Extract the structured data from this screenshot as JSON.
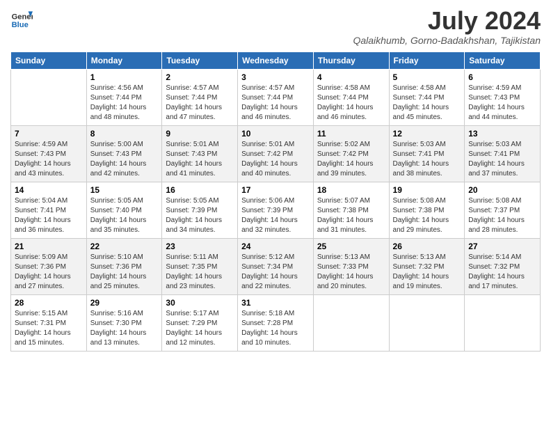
{
  "header": {
    "logo_line1": "General",
    "logo_line2": "Blue",
    "title": "July 2024",
    "subtitle": "Qalaikhumb, Gorno-Badakhshan, Tajikistan"
  },
  "days_of_week": [
    "Sunday",
    "Monday",
    "Tuesday",
    "Wednesday",
    "Thursday",
    "Friday",
    "Saturday"
  ],
  "weeks": [
    [
      {
        "num": "",
        "info": ""
      },
      {
        "num": "1",
        "info": "Sunrise: 4:56 AM\nSunset: 7:44 PM\nDaylight: 14 hours\nand 48 minutes."
      },
      {
        "num": "2",
        "info": "Sunrise: 4:57 AM\nSunset: 7:44 PM\nDaylight: 14 hours\nand 47 minutes."
      },
      {
        "num": "3",
        "info": "Sunrise: 4:57 AM\nSunset: 7:44 PM\nDaylight: 14 hours\nand 46 minutes."
      },
      {
        "num": "4",
        "info": "Sunrise: 4:58 AM\nSunset: 7:44 PM\nDaylight: 14 hours\nand 46 minutes."
      },
      {
        "num": "5",
        "info": "Sunrise: 4:58 AM\nSunset: 7:44 PM\nDaylight: 14 hours\nand 45 minutes."
      },
      {
        "num": "6",
        "info": "Sunrise: 4:59 AM\nSunset: 7:43 PM\nDaylight: 14 hours\nand 44 minutes."
      }
    ],
    [
      {
        "num": "7",
        "info": "Sunrise: 4:59 AM\nSunset: 7:43 PM\nDaylight: 14 hours\nand 43 minutes."
      },
      {
        "num": "8",
        "info": "Sunrise: 5:00 AM\nSunset: 7:43 PM\nDaylight: 14 hours\nand 42 minutes."
      },
      {
        "num": "9",
        "info": "Sunrise: 5:01 AM\nSunset: 7:43 PM\nDaylight: 14 hours\nand 41 minutes."
      },
      {
        "num": "10",
        "info": "Sunrise: 5:01 AM\nSunset: 7:42 PM\nDaylight: 14 hours\nand 40 minutes."
      },
      {
        "num": "11",
        "info": "Sunrise: 5:02 AM\nSunset: 7:42 PM\nDaylight: 14 hours\nand 39 minutes."
      },
      {
        "num": "12",
        "info": "Sunrise: 5:03 AM\nSunset: 7:41 PM\nDaylight: 14 hours\nand 38 minutes."
      },
      {
        "num": "13",
        "info": "Sunrise: 5:03 AM\nSunset: 7:41 PM\nDaylight: 14 hours\nand 37 minutes."
      }
    ],
    [
      {
        "num": "14",
        "info": "Sunrise: 5:04 AM\nSunset: 7:41 PM\nDaylight: 14 hours\nand 36 minutes."
      },
      {
        "num": "15",
        "info": "Sunrise: 5:05 AM\nSunset: 7:40 PM\nDaylight: 14 hours\nand 35 minutes."
      },
      {
        "num": "16",
        "info": "Sunrise: 5:05 AM\nSunset: 7:39 PM\nDaylight: 14 hours\nand 34 minutes."
      },
      {
        "num": "17",
        "info": "Sunrise: 5:06 AM\nSunset: 7:39 PM\nDaylight: 14 hours\nand 32 minutes."
      },
      {
        "num": "18",
        "info": "Sunrise: 5:07 AM\nSunset: 7:38 PM\nDaylight: 14 hours\nand 31 minutes."
      },
      {
        "num": "19",
        "info": "Sunrise: 5:08 AM\nSunset: 7:38 PM\nDaylight: 14 hours\nand 29 minutes."
      },
      {
        "num": "20",
        "info": "Sunrise: 5:08 AM\nSunset: 7:37 PM\nDaylight: 14 hours\nand 28 minutes."
      }
    ],
    [
      {
        "num": "21",
        "info": "Sunrise: 5:09 AM\nSunset: 7:36 PM\nDaylight: 14 hours\nand 27 minutes."
      },
      {
        "num": "22",
        "info": "Sunrise: 5:10 AM\nSunset: 7:36 PM\nDaylight: 14 hours\nand 25 minutes."
      },
      {
        "num": "23",
        "info": "Sunrise: 5:11 AM\nSunset: 7:35 PM\nDaylight: 14 hours\nand 23 minutes."
      },
      {
        "num": "24",
        "info": "Sunrise: 5:12 AM\nSunset: 7:34 PM\nDaylight: 14 hours\nand 22 minutes."
      },
      {
        "num": "25",
        "info": "Sunrise: 5:13 AM\nSunset: 7:33 PM\nDaylight: 14 hours\nand 20 minutes."
      },
      {
        "num": "26",
        "info": "Sunrise: 5:13 AM\nSunset: 7:32 PM\nDaylight: 14 hours\nand 19 minutes."
      },
      {
        "num": "27",
        "info": "Sunrise: 5:14 AM\nSunset: 7:32 PM\nDaylight: 14 hours\nand 17 minutes."
      }
    ],
    [
      {
        "num": "28",
        "info": "Sunrise: 5:15 AM\nSunset: 7:31 PM\nDaylight: 14 hours\nand 15 minutes."
      },
      {
        "num": "29",
        "info": "Sunrise: 5:16 AM\nSunset: 7:30 PM\nDaylight: 14 hours\nand 13 minutes."
      },
      {
        "num": "30",
        "info": "Sunrise: 5:17 AM\nSunset: 7:29 PM\nDaylight: 14 hours\nand 12 minutes."
      },
      {
        "num": "31",
        "info": "Sunrise: 5:18 AM\nSunset: 7:28 PM\nDaylight: 14 hours\nand 10 minutes."
      },
      {
        "num": "",
        "info": ""
      },
      {
        "num": "",
        "info": ""
      },
      {
        "num": "",
        "info": ""
      }
    ]
  ]
}
